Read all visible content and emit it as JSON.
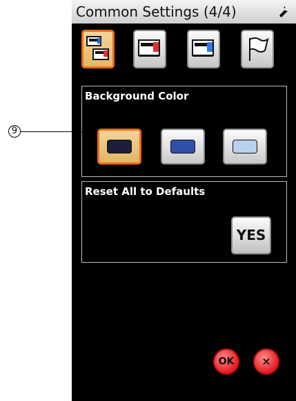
{
  "header": {
    "title": "Common Settings (4/4)",
    "settings_icon": "wrench-icon"
  },
  "tabs": [
    {
      "icon": "machine-combined-icon",
      "selected": true
    },
    {
      "icon": "sewing-machine-red-icon",
      "selected": false
    },
    {
      "icon": "sewing-machine-blue-icon",
      "selected": false
    },
    {
      "icon": "flag-icon",
      "selected": false
    }
  ],
  "background_color": {
    "title": "Background Color",
    "options": [
      {
        "color": "#1e1d3a",
        "selected": true
      },
      {
        "color": "#2f50a8",
        "selected": false
      },
      {
        "color": "#b9d1f1",
        "selected": false
      }
    ]
  },
  "reset": {
    "title": "Reset All to Defaults",
    "yes_label": "YES"
  },
  "footer": {
    "ok_label": "OK",
    "close_label": "×"
  },
  "callout": {
    "label": "9"
  }
}
